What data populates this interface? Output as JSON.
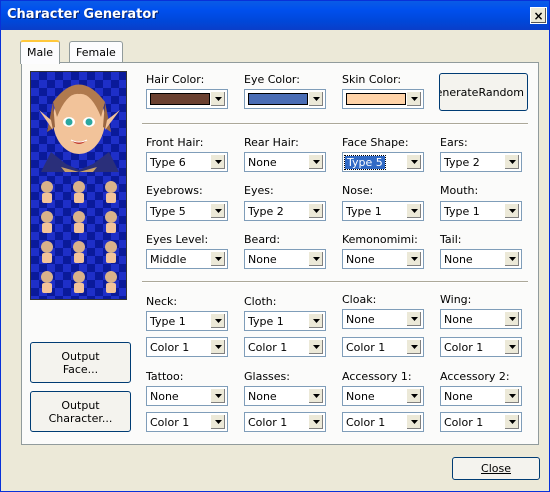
{
  "window": {
    "title": "Character Generator",
    "close": "×"
  },
  "tabs": [
    {
      "label": "Male"
    },
    {
      "label": "Female"
    }
  ],
  "colors": {
    "hair": "#6b4131",
    "eye": "#4a6db5",
    "skin": "#ffd3a8",
    "titlebar": "#0050ee",
    "highlight": "#316ac5"
  },
  "color_row": {
    "hair_label": "Hair Color:",
    "eye_label": "Eye Color:",
    "skin_label": "Skin Color:",
    "random_button": "enerateRandom"
  },
  "row1": {
    "front_hair": {
      "label": "Front Hair:",
      "value": "Type 6"
    },
    "rear_hair": {
      "label": "Rear Hair:",
      "value": "None"
    },
    "face_shape": {
      "label": "Face Shape:",
      "value": "Type 5"
    },
    "ears": {
      "label": "Ears:",
      "value": "Type 2"
    }
  },
  "row2": {
    "eyebrows": {
      "label": "Eyebrows:",
      "value": "Type 5"
    },
    "eyes": {
      "label": "Eyes:",
      "value": "Type 2"
    },
    "nose": {
      "label": "Nose:",
      "value": "Type 1"
    },
    "mouth": {
      "label": "Mouth:",
      "value": "Type 1"
    }
  },
  "row3": {
    "eyes_level": {
      "label": "Eyes Level:",
      "value": "Middle"
    },
    "beard": {
      "label": "Beard:",
      "value": "None"
    },
    "kemonomimi": {
      "label": "Kemonomimi:",
      "value": "None"
    },
    "tail": {
      "label": "Tail:",
      "value": "None"
    }
  },
  "row4": {
    "neck": {
      "label": "Neck:",
      "value": "Type 1",
      "color": "Color 1"
    },
    "cloth": {
      "label": "Cloth:",
      "value": "Type 1",
      "color": "Color 1"
    },
    "cloak": {
      "label": "Cloak:",
      "value": "None",
      "color": "Color 1"
    },
    "wing": {
      "label": "Wing:",
      "value": "None",
      "color": "Color 1"
    }
  },
  "row5": {
    "tattoo": {
      "label": "Tattoo:",
      "value": "None",
      "color": "Color 1"
    },
    "glasses": {
      "label": "Glasses:",
      "value": "None",
      "color": "Color 1"
    },
    "accessory1": {
      "label": "Accessory 1:",
      "value": "None",
      "color": "Color 1"
    },
    "accessory2": {
      "label": "Accessory 2:",
      "value": "None",
      "color": "Color 1"
    }
  },
  "buttons": {
    "output_face_1": "Output",
    "output_face_2": "Face...",
    "output_char_1": "Output",
    "output_char_2": "Character...",
    "close": "Close"
  }
}
